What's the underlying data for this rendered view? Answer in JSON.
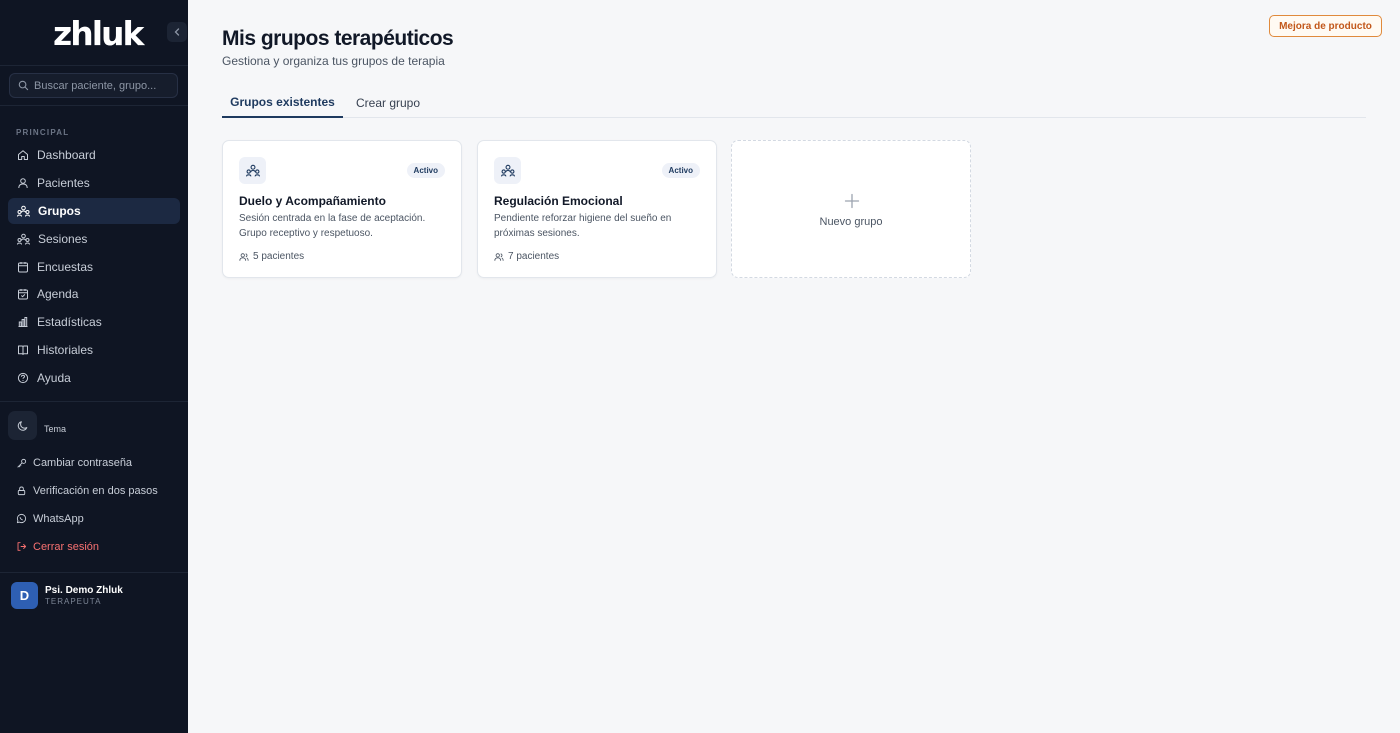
{
  "sidebar": {
    "logo": "zhluk",
    "search_placeholder": "Buscar paciente, grupo...",
    "section_label": "PRINCIPAL",
    "nav": [
      {
        "label": "Dashboard",
        "icon": "home-icon",
        "active": false
      },
      {
        "label": "Pacientes",
        "icon": "user-icon",
        "active": false
      },
      {
        "label": "Grupos",
        "icon": "group-icon",
        "active": true
      },
      {
        "label": "Sesiones",
        "icon": "sessions-icon",
        "active": false
      },
      {
        "label": "Encuestas",
        "icon": "survey-icon",
        "active": false
      },
      {
        "label": "Agenda",
        "icon": "calendar-icon",
        "active": false
      },
      {
        "label": "Estadísticas",
        "icon": "chart-icon",
        "active": false
      },
      {
        "label": "Historiales",
        "icon": "book-icon",
        "active": false
      },
      {
        "label": "Ayuda",
        "icon": "help-icon",
        "active": false
      }
    ],
    "theme_label": "Tema",
    "account": [
      {
        "label": "Cambiar contraseña",
        "icon": "key-icon"
      },
      {
        "label": "Verificación en dos pasos",
        "icon": "lock-icon"
      },
      {
        "label": "WhatsApp",
        "icon": "whatsapp-icon"
      },
      {
        "label": "Cerrar sesión",
        "icon": "logout-icon"
      }
    ],
    "user": {
      "initial": "D",
      "name": "Psi. Demo Zhluk",
      "role": "TERAPEUTA"
    }
  },
  "header": {
    "improve_button": "Mejora de producto",
    "title": "Mis grupos terapéuticos",
    "subtitle": "Gestiona y organiza tus grupos de terapia"
  },
  "tabs": [
    {
      "label": "Grupos existentes",
      "active": true
    },
    {
      "label": "Crear grupo",
      "active": false
    }
  ],
  "groups": [
    {
      "status": "Activo",
      "title": "Duelo y Acompañamiento",
      "description": "Sesión centrada en la fase de aceptación. Grupo receptivo y respetuoso.",
      "patients": "5 pacientes"
    },
    {
      "status": "Activo",
      "title": "Regulación Emocional",
      "description": "Pendiente reforzar higiene del sueño en próximas sesiones.",
      "patients": "7 pacientes"
    }
  ],
  "new_group_label": "Nuevo grupo",
  "colors": {
    "sidebar_bg": "#0f1523",
    "accent": "#1e3a5f",
    "improve_border": "#e08a3c",
    "logout": "#f87171"
  }
}
